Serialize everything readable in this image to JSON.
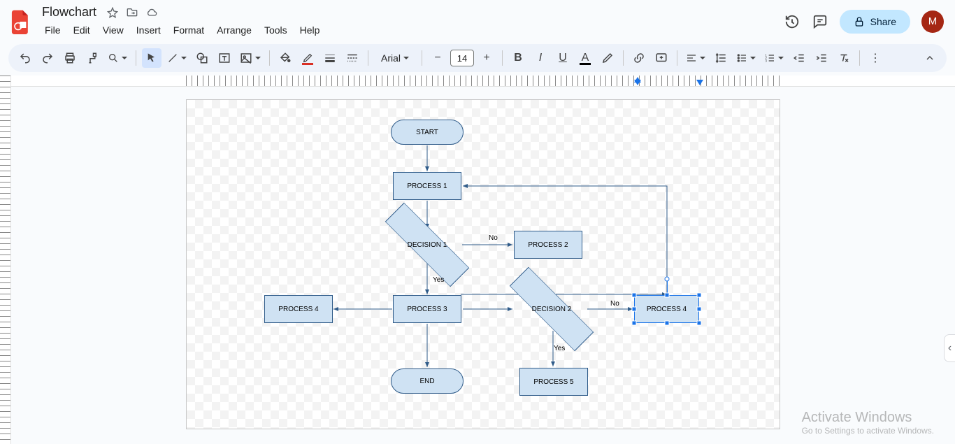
{
  "doc": {
    "title": "Flowchart"
  },
  "menus": {
    "file": "File",
    "edit": "Edit",
    "view": "View",
    "insert": "Insert",
    "format": "Format",
    "arrange": "Arrange",
    "tools": "Tools",
    "help": "Help"
  },
  "share": {
    "label": "Share"
  },
  "avatar": {
    "letter": "M"
  },
  "toolbar": {
    "font": "Arial",
    "size": "14"
  },
  "watermark": {
    "title": "Activate Windows",
    "sub": "Go to Settings to activate Windows."
  },
  "nodes": {
    "start": {
      "label": "START"
    },
    "p1": {
      "label": "PROCESS 1"
    },
    "d1": {
      "label": "DECISION 1"
    },
    "p2": {
      "label": "PROCESS 2"
    },
    "p3": {
      "label": "PROCESS 3"
    },
    "p4l": {
      "label": "PROCESS 4"
    },
    "d2": {
      "label": "DECISION 2"
    },
    "p4r": {
      "label": "PROCESS 4"
    },
    "p5": {
      "label": "PROCESS 5"
    },
    "end": {
      "label": "END"
    }
  },
  "labels": {
    "d1_no": "No",
    "d1_yes": "Yes",
    "d2_no": "No",
    "d2_yes": "Yes"
  }
}
